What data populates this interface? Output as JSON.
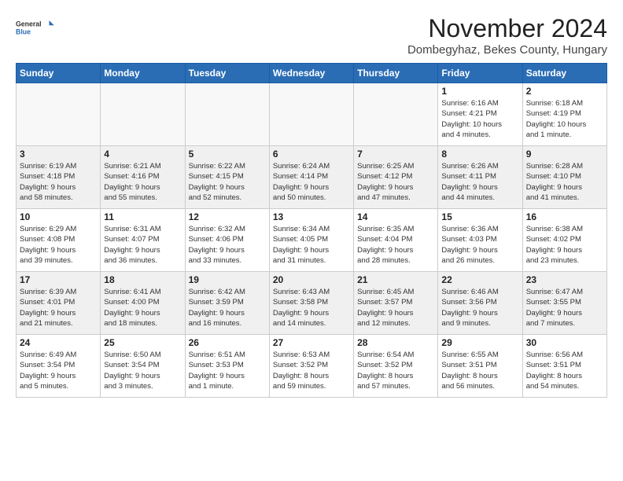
{
  "logo": {
    "general": "General",
    "blue": "Blue"
  },
  "title": "November 2024",
  "location": "Dombegyhaz, Bekes County, Hungary",
  "days_of_week": [
    "Sunday",
    "Monday",
    "Tuesday",
    "Wednesday",
    "Thursday",
    "Friday",
    "Saturday"
  ],
  "weeks": [
    [
      {
        "day": "",
        "info": ""
      },
      {
        "day": "",
        "info": ""
      },
      {
        "day": "",
        "info": ""
      },
      {
        "day": "",
        "info": ""
      },
      {
        "day": "",
        "info": ""
      },
      {
        "day": "1",
        "info": "Sunrise: 6:16 AM\nSunset: 4:21 PM\nDaylight: 10 hours\nand 4 minutes."
      },
      {
        "day": "2",
        "info": "Sunrise: 6:18 AM\nSunset: 4:19 PM\nDaylight: 10 hours\nand 1 minute."
      }
    ],
    [
      {
        "day": "3",
        "info": "Sunrise: 6:19 AM\nSunset: 4:18 PM\nDaylight: 9 hours\nand 58 minutes."
      },
      {
        "day": "4",
        "info": "Sunrise: 6:21 AM\nSunset: 4:16 PM\nDaylight: 9 hours\nand 55 minutes."
      },
      {
        "day": "5",
        "info": "Sunrise: 6:22 AM\nSunset: 4:15 PM\nDaylight: 9 hours\nand 52 minutes."
      },
      {
        "day": "6",
        "info": "Sunrise: 6:24 AM\nSunset: 4:14 PM\nDaylight: 9 hours\nand 50 minutes."
      },
      {
        "day": "7",
        "info": "Sunrise: 6:25 AM\nSunset: 4:12 PM\nDaylight: 9 hours\nand 47 minutes."
      },
      {
        "day": "8",
        "info": "Sunrise: 6:26 AM\nSunset: 4:11 PM\nDaylight: 9 hours\nand 44 minutes."
      },
      {
        "day": "9",
        "info": "Sunrise: 6:28 AM\nSunset: 4:10 PM\nDaylight: 9 hours\nand 41 minutes."
      }
    ],
    [
      {
        "day": "10",
        "info": "Sunrise: 6:29 AM\nSunset: 4:08 PM\nDaylight: 9 hours\nand 39 minutes."
      },
      {
        "day": "11",
        "info": "Sunrise: 6:31 AM\nSunset: 4:07 PM\nDaylight: 9 hours\nand 36 minutes."
      },
      {
        "day": "12",
        "info": "Sunrise: 6:32 AM\nSunset: 4:06 PM\nDaylight: 9 hours\nand 33 minutes."
      },
      {
        "day": "13",
        "info": "Sunrise: 6:34 AM\nSunset: 4:05 PM\nDaylight: 9 hours\nand 31 minutes."
      },
      {
        "day": "14",
        "info": "Sunrise: 6:35 AM\nSunset: 4:04 PM\nDaylight: 9 hours\nand 28 minutes."
      },
      {
        "day": "15",
        "info": "Sunrise: 6:36 AM\nSunset: 4:03 PM\nDaylight: 9 hours\nand 26 minutes."
      },
      {
        "day": "16",
        "info": "Sunrise: 6:38 AM\nSunset: 4:02 PM\nDaylight: 9 hours\nand 23 minutes."
      }
    ],
    [
      {
        "day": "17",
        "info": "Sunrise: 6:39 AM\nSunset: 4:01 PM\nDaylight: 9 hours\nand 21 minutes."
      },
      {
        "day": "18",
        "info": "Sunrise: 6:41 AM\nSunset: 4:00 PM\nDaylight: 9 hours\nand 18 minutes."
      },
      {
        "day": "19",
        "info": "Sunrise: 6:42 AM\nSunset: 3:59 PM\nDaylight: 9 hours\nand 16 minutes."
      },
      {
        "day": "20",
        "info": "Sunrise: 6:43 AM\nSunset: 3:58 PM\nDaylight: 9 hours\nand 14 minutes."
      },
      {
        "day": "21",
        "info": "Sunrise: 6:45 AM\nSunset: 3:57 PM\nDaylight: 9 hours\nand 12 minutes."
      },
      {
        "day": "22",
        "info": "Sunrise: 6:46 AM\nSunset: 3:56 PM\nDaylight: 9 hours\nand 9 minutes."
      },
      {
        "day": "23",
        "info": "Sunrise: 6:47 AM\nSunset: 3:55 PM\nDaylight: 9 hours\nand 7 minutes."
      }
    ],
    [
      {
        "day": "24",
        "info": "Sunrise: 6:49 AM\nSunset: 3:54 PM\nDaylight: 9 hours\nand 5 minutes."
      },
      {
        "day": "25",
        "info": "Sunrise: 6:50 AM\nSunset: 3:54 PM\nDaylight: 9 hours\nand 3 minutes."
      },
      {
        "day": "26",
        "info": "Sunrise: 6:51 AM\nSunset: 3:53 PM\nDaylight: 9 hours\nand 1 minute."
      },
      {
        "day": "27",
        "info": "Sunrise: 6:53 AM\nSunset: 3:52 PM\nDaylight: 8 hours\nand 59 minutes."
      },
      {
        "day": "28",
        "info": "Sunrise: 6:54 AM\nSunset: 3:52 PM\nDaylight: 8 hours\nand 57 minutes."
      },
      {
        "day": "29",
        "info": "Sunrise: 6:55 AM\nSunset: 3:51 PM\nDaylight: 8 hours\nand 56 minutes."
      },
      {
        "day": "30",
        "info": "Sunrise: 6:56 AM\nSunset: 3:51 PM\nDaylight: 8 hours\nand 54 minutes."
      }
    ]
  ]
}
